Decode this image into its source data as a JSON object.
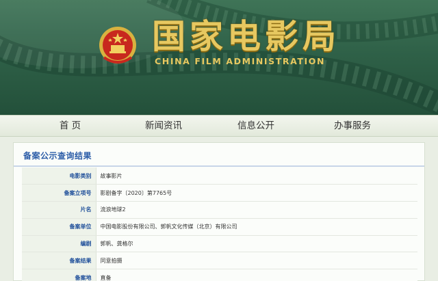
{
  "header": {
    "title_cn": "国家电影局",
    "title_en": "CHINA FILM ADMINISTRATION"
  },
  "nav": {
    "items": [
      "首 页",
      "新闻资讯",
      "信息公开",
      "办事服务"
    ]
  },
  "panel": {
    "title": "备案公示查询结果",
    "rows": [
      {
        "label": "电影类别",
        "value": "故事影片"
      },
      {
        "label": "备案立项号",
        "value": "影剧备字〔2020〕第7765号"
      },
      {
        "label": "片名",
        "value": "流浪地球2"
      },
      {
        "label": "备案单位",
        "value": "中国电影股份有限公司、郭帆文化传媒（北京）有限公司"
      },
      {
        "label": "编剧",
        "value": "郭帆、龚格尔"
      },
      {
        "label": "备案结果",
        "value": "同意拍摄"
      },
      {
        "label": "备案地",
        "value": "直备"
      }
    ]
  },
  "colors": {
    "banner_green": "#2f6148",
    "gold": "#e7c860",
    "label_blue": "#1f4f9a",
    "title_blue": "#2c5da8"
  }
}
